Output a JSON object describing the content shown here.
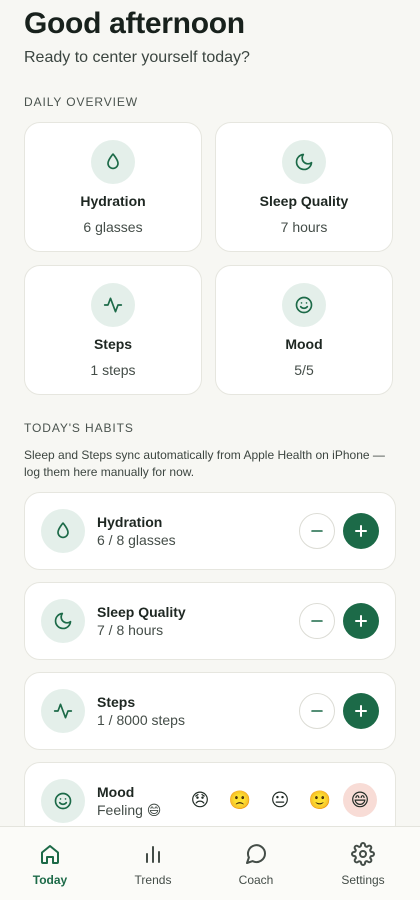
{
  "header": {
    "greeting": "Good afternoon",
    "subtitle": "Ready to center yourself today?"
  },
  "overview": {
    "label": "DAILY OVERVIEW",
    "cards": [
      {
        "title": "Hydration",
        "value": "6 glasses",
        "icon": "droplet-icon"
      },
      {
        "title": "Sleep Quality",
        "value": "7 hours",
        "icon": "moon-icon"
      },
      {
        "title": "Steps",
        "value": "1 steps",
        "icon": "activity-icon"
      },
      {
        "title": "Mood",
        "value": "5/5",
        "icon": "smile-icon"
      }
    ]
  },
  "habits": {
    "label": "TODAY'S HABITS",
    "note": "Sleep and Steps sync automatically from Apple Health on iPhone — log them here manually for now.",
    "items": [
      {
        "title": "Hydration",
        "progress": "6 / 8 glasses",
        "icon": "droplet-icon"
      },
      {
        "title": "Sleep Quality",
        "progress": "7 / 8 hours",
        "icon": "moon-icon"
      },
      {
        "title": "Steps",
        "progress": "1 / 8000 steps",
        "icon": "activity-icon"
      }
    ],
    "mood": {
      "title": "Mood",
      "progress": "Feeling 😄",
      "options": [
        "😞",
        "🙁",
        "😐",
        "🙂",
        "😄"
      ],
      "selected_index": 4
    }
  },
  "tabs": [
    {
      "label": "Today",
      "icon": "home-icon",
      "active": true
    },
    {
      "label": "Trends",
      "icon": "bar-chart-icon",
      "active": false
    },
    {
      "label": "Coach",
      "icon": "chat-bubble-icon",
      "active": false
    },
    {
      "label": "Settings",
      "icon": "gear-icon",
      "active": false
    }
  ],
  "colors": {
    "accent": "#1c6a48",
    "icon_bg": "#e4efea",
    "background": "#f7f7f3",
    "mood_selected": "#f8dcd6"
  }
}
